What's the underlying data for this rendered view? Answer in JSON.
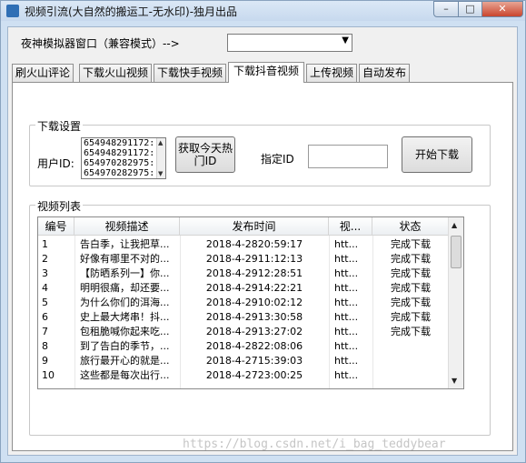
{
  "window": {
    "title": "视频引流(大自然的搬运工-无水印)-独月出品",
    "controls": {
      "minimize": "–",
      "maximize": "□",
      "close": "✕"
    }
  },
  "emulator": {
    "label": "夜神模拟器窗口（兼容模式）-->",
    "selected_value": "",
    "dropdown_icon": "chevron-down-icon"
  },
  "tabs": [
    {
      "label": "刷火山评论",
      "active": false
    },
    {
      "label": "下载火山视频",
      "active": false
    },
    {
      "label": "下载快手视频",
      "active": false
    },
    {
      "label": "下载抖音视频",
      "active": true
    },
    {
      "label": "上传视频",
      "active": false
    },
    {
      "label": "自动发布",
      "active": false
    }
  ],
  "download_settings": {
    "group_label": "下载设置",
    "user_id_label": "用户ID:",
    "user_ids": [
      "654948291172:",
      "654948291172:",
      "654970282975:",
      "654970282975:"
    ],
    "hot_id_button": "获取今天热门ID",
    "specified_id_label": "指定ID",
    "specified_id_value": "",
    "start_button": "开始下载"
  },
  "video_list": {
    "group_label": "视频列表",
    "columns": [
      "编号",
      "视频描述",
      "发布时间",
      "视...",
      "状态"
    ],
    "rows": [
      {
        "no": "1",
        "desc": "告白季，让我把草...",
        "time": "2018-4-2820:59:17",
        "url": "htt...",
        "status": "完成下载"
      },
      {
        "no": "2",
        "desc": "好像有哪里不对的...",
        "time": "2018-4-2911:12:13",
        "url": "htt...",
        "status": "完成下载"
      },
      {
        "no": "3",
        "desc": "【防晒系列一】你...",
        "time": "2018-4-2912:28:51",
        "url": "htt...",
        "status": "完成下载"
      },
      {
        "no": "4",
        "desc": "明明很痛，却还要...",
        "time": "2018-4-2914:22:21",
        "url": "htt...",
        "status": "完成下载"
      },
      {
        "no": "5",
        "desc": "为什么你们的洱海...",
        "time": "2018-4-2910:02:12",
        "url": "htt...",
        "status": "完成下载"
      },
      {
        "no": "6",
        "desc": "史上最大烤串！抖...",
        "time": "2018-4-2913:30:58",
        "url": "htt...",
        "status": "完成下载"
      },
      {
        "no": "7",
        "desc": "包租脆喊你起来吃...",
        "time": "2018-4-2913:27:02",
        "url": "htt...",
        "status": "完成下载"
      },
      {
        "no": "8",
        "desc": "到了告白的季节，...",
        "time": "2018-4-2822:08:06",
        "url": "htt...",
        "status": ""
      },
      {
        "no": "9",
        "desc": "旅行最开心的就是...",
        "time": "2018-4-2715:39:03",
        "url": "htt...",
        "status": ""
      },
      {
        "no": "10",
        "desc": "这些都是每次出行...",
        "time": "2018-4-2723:00:25",
        "url": "htt...",
        "status": ""
      }
    ]
  },
  "watermark": "https://blog.csdn.net/i_bag_teddybear"
}
